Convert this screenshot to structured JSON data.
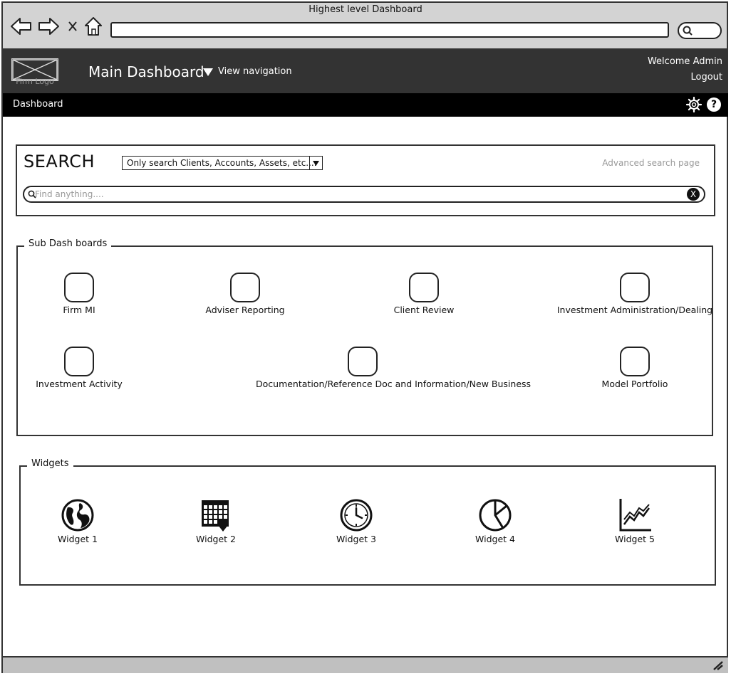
{
  "window": {
    "title": "Highest level Dashboard"
  },
  "browser": {
    "back_icon": "arrow-left-icon",
    "forward_icon": "arrow-right-icon",
    "stop_icon": "close-icon",
    "home_icon": "home-icon",
    "search_icon": "search-icon",
    "url": ""
  },
  "header": {
    "logo_label": "Firm Logo",
    "title": "Main Dashboard",
    "view_navigation": "View navigation",
    "welcome": "Welcome Admin",
    "logout": "Logout"
  },
  "subbar": {
    "breadcrumb": "Dashboard",
    "settings_icon": "gear-icon",
    "help_glyph": "?"
  },
  "search": {
    "title": "SEARCH",
    "scope_selected": "Only search Clients, Accounts, Assets, etc....",
    "advanced_link": "Advanced search page",
    "placeholder": "Find anything....",
    "clear_glyph": "X"
  },
  "subdashboards": {
    "legend": "Sub Dash boards",
    "items": [
      {
        "label": "Firm MI"
      },
      {
        "label": "Adviser Reporting"
      },
      {
        "label": "Client Review"
      },
      {
        "label": "Investment Administration/Dealing"
      },
      {
        "label": "Investment Activity"
      },
      {
        "label": "Documentation/Reference Doc and Information/New Business"
      },
      {
        "label": "Model Portfolio"
      }
    ]
  },
  "widgets": {
    "legend": "Widgets",
    "items": [
      {
        "label": "Widget 1",
        "icon": "globe-icon"
      },
      {
        "label": "Widget 2",
        "icon": "calendar-icon"
      },
      {
        "label": "Widget 3",
        "icon": "clock-icon"
      },
      {
        "label": "Widget 4",
        "icon": "pie-chart-icon"
      },
      {
        "label": "Widget 5",
        "icon": "line-chart-icon"
      }
    ]
  },
  "colors": {
    "header_bg": "#333333",
    "subbar_bg": "#000000",
    "chrome_bg": "#d3d3d3",
    "muted_text": "#999999"
  }
}
